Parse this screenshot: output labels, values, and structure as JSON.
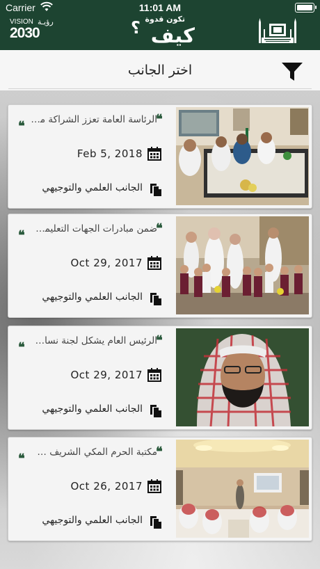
{
  "status_bar": {
    "carrier": "Carrier",
    "time": "11:01 AM"
  },
  "header": {
    "vision_label": "VISION",
    "vision_arabic": "رؤيـة",
    "vision_year": "2030",
    "slogan_top": "تكون قدوة",
    "slogan_main": "كيف",
    "slogan_mark": "؟",
    "logo_icon": "haram-mosque-logo-icon",
    "brand_color": "#1d4431"
  },
  "toolbar": {
    "title": "اختر الجانب",
    "filter_icon": "filter-icon"
  },
  "cards": [
    {
      "title": "الرئاسة العامة تعزز الشراكة مع...",
      "date": "Feb 5, 2018",
      "category": "الجانب العلمي والتوجيهي",
      "image": "meeting-photo"
    },
    {
      "title": "ضمن مبادرات الجهات التعليمي...",
      "date": "Oct 29, 2017",
      "category": "الجانب العلمي والتوجيهي",
      "image": "children-group-photo"
    },
    {
      "title": "الرئيس العام يشكل لجنة نسائ...",
      "date": "Oct 29, 2017",
      "category": "الجانب العلمي والتوجيهي",
      "image": "portrait-photo"
    },
    {
      "title": "مكتبة الحرم المكي الشريف ت...",
      "date": "Oct 26, 2017",
      "category": "الجانب العلمي والتوجيهي",
      "image": "conference-hall-photo"
    }
  ],
  "colors": {
    "quote": "#2a5a3c",
    "card_bg": "#f4f4f4",
    "titlebar_bg": "#f6f6f6"
  }
}
